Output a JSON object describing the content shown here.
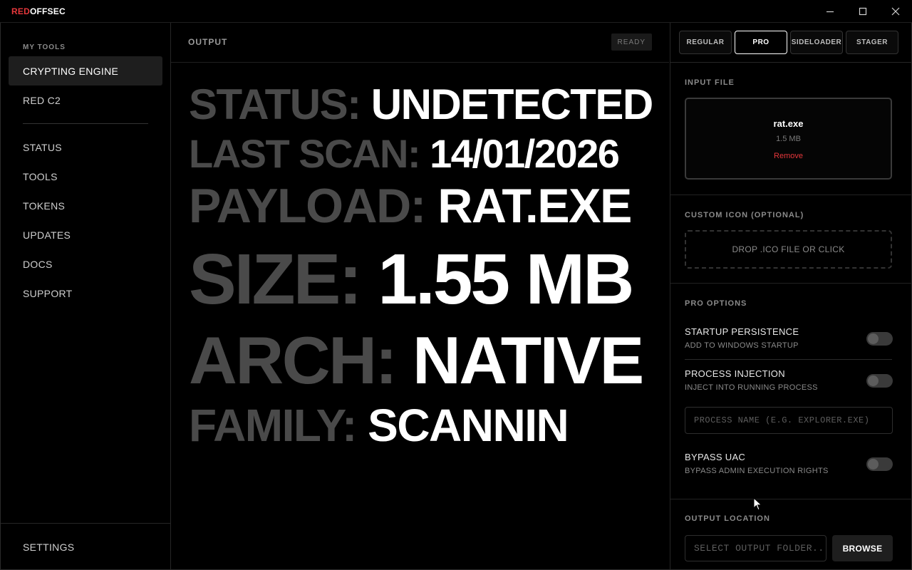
{
  "titlebar": {
    "brand_red": "RED",
    "brand_white": "OFFSEC"
  },
  "sidebar": {
    "heading": "MY TOOLS",
    "tools": [
      {
        "label": "CRYPTING ENGINE",
        "active": true
      },
      {
        "label": "RED C2",
        "active": false
      }
    ],
    "items": [
      {
        "label": "STATUS"
      },
      {
        "label": "TOOLS"
      },
      {
        "label": "TOKENS"
      },
      {
        "label": "UPDATES"
      },
      {
        "label": "DOCS"
      },
      {
        "label": "SUPPORT"
      }
    ],
    "settings_label": "SETTINGS"
  },
  "output": {
    "title": "OUTPUT",
    "badge": "READY",
    "lines": [
      {
        "label": "STATUS:",
        "value": "UNDETECTED"
      },
      {
        "label": "LAST SCAN:",
        "value": "14/01/2026"
      },
      {
        "label": "PAYLOAD:",
        "value": "RAT.EXE"
      },
      {
        "label": "SIZE:",
        "value": "1.55 MB"
      },
      {
        "label": "ARCH:",
        "value": "NATIVE"
      },
      {
        "label": "FAMILY:",
        "value": "SCANNIN"
      }
    ]
  },
  "panel": {
    "tabs": [
      {
        "label": "REGULAR",
        "active": false
      },
      {
        "label": "PRO",
        "active": true
      },
      {
        "label": "SIDELOADER",
        "active": false
      },
      {
        "label": "STAGER",
        "active": false
      }
    ],
    "input_file": {
      "title": "INPUT FILE",
      "file_name": "rat.exe",
      "file_size": "1.5 MB",
      "remove_label": "Remove"
    },
    "custom_icon": {
      "title": "CUSTOM ICON (OPTIONAL)",
      "drop_label": "DROP .ICO FILE OR CLICK"
    },
    "pro_options": {
      "title": "PRO OPTIONS",
      "options": [
        {
          "title": "STARTUP PERSISTENCE",
          "subtitle": "ADD TO WINDOWS STARTUP",
          "enabled": false
        },
        {
          "title": "PROCESS INJECTION",
          "subtitle": "INJECT INTO RUNNING PROCESS",
          "enabled": false
        },
        {
          "title": "BYPASS UAC",
          "subtitle": "BYPASS ADMIN EXECUTION RIGHTS",
          "enabled": false
        }
      ],
      "process_placeholder": "PROCESS NAME (E.G. EXPLORER.EXE)"
    },
    "output_location": {
      "title": "OUTPUT LOCATION",
      "placeholder": "SELECT OUTPUT FOLDER...",
      "browse_label": "BROWSE"
    }
  },
  "colors": {
    "accent_red": "#e5373b",
    "background": "#000000",
    "label_gray": "#4a4a4a"
  }
}
